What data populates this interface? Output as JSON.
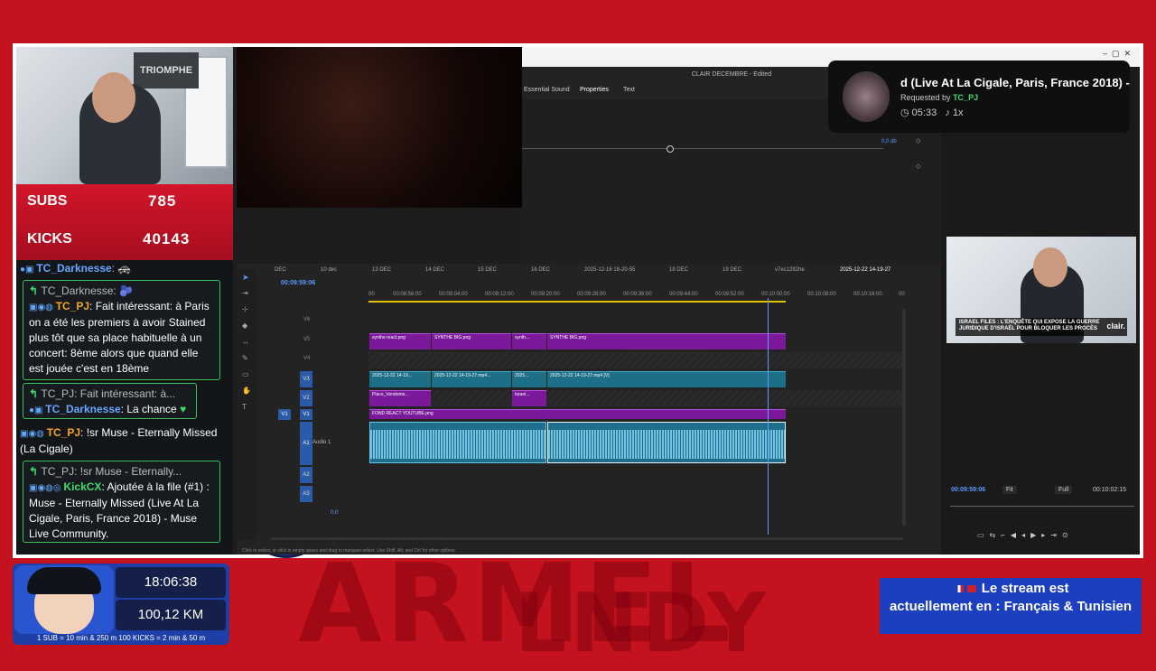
{
  "premiere": {
    "window_title": "CLAIR DECEMBRE - Edited",
    "tabs": [
      "Essential Sound",
      "Properties",
      "Text"
    ],
    "panel_value": "0,0 db",
    "timecode": "00:09:59:06",
    "sequence_tabs": [
      "DEC",
      "10 dec",
      "13 DEC",
      "14 DEC",
      "15 DEC",
      "16 DEC",
      "2025-12-16 16-20-55",
      "18 DEC",
      "19 DEC",
      "v7ec1282he",
      "2025-12-22 14-19-27"
    ],
    "ruler_ticks": [
      "00",
      "00:08:56:00",
      "00:09:04:00",
      "00:09:12:00",
      "00:09:20:00",
      "00:09:28:00",
      "00:09:36:00",
      "00:09:44:00",
      "00:09:52:00",
      "00:10:00:00",
      "00:10:08:00",
      "00:10:16:00",
      "00"
    ],
    "track_labels": [
      "V6",
      "V5",
      "V4",
      "V3",
      "V2",
      "V1",
      "A1",
      "A2",
      "A3",
      "0,0"
    ],
    "audio_track_name": "Audio 1",
    "clips": {
      "v5": [
        "synthe react.png",
        "SYNTHE BIG.png",
        "synth...",
        "SYNTHE BIG.png"
      ],
      "v3": [
        "2025-12-22 14-19...",
        "2025-12-22 14-19-27.mp4...",
        "2025...",
        "2025-12-22 14-19-27.mp4 [V]"
      ],
      "v2": [
        "Place_Vendome...",
        "Israel..."
      ],
      "v1": [
        "FOND REACT YOUTUBE.png"
      ]
    },
    "status_text": "Click to select, or click in empty space and drag to marquee select. Use Shift, Alt, and Ctrl for other options.",
    "program_timecode": "00:09:59:06",
    "program_end": "00:10:02:15",
    "fit_label": "Fit",
    "full_label": "Full"
  },
  "now_playing": {
    "title": "d (Live At La Cigale, Paris, France 2018) -",
    "requested_prefix": "Requested by",
    "requester": "TC_PJ",
    "duration": "05:33",
    "speed": "1x"
  },
  "overlay": {
    "subs_label": "SUBS",
    "subs_value": "785",
    "kicks_label": "KICKS",
    "kicks_value": "40143",
    "cam_poster": "TRIOMPHE",
    "cam2_banner": "ISRAEL FILES : L'ENQUÊTE QUI EXPOSE LA GUERRE JURIDIQUE D'ISRAËL POUR BLOQUER LES PROCÈS",
    "cam2_logo": "clair."
  },
  "chat": [
    {
      "user": "TC_Darknesse",
      "text": ""
    },
    {
      "user": "TC_Darknesse",
      "text": ""
    },
    {
      "user": "TC_PJ",
      "text": "Fait intéressant: à Paris on a été les premiers à avoir Stained plus tôt que sa place habituelle à un concert: 8ème alors que quand elle est jouée c'est en 18ème"
    },
    {
      "reply_user": "TC_PJ",
      "reply_text": "Fait intéressant: à...",
      "user": "TC_Darknesse",
      "text": "La chance"
    },
    {
      "user": "TC_PJ",
      "text": "!sr Muse - Eternally Missed (La Cigale)"
    },
    {
      "reply_user": "TC_PJ",
      "reply_text": "!sr Muse - Eternally...",
      "user": "KickCX",
      "text": "Ajoutée à la file (#1) : Muse - Eternally Missed (Live At La Cigale, Paris, France 2018) - Muse Live Community."
    }
  ],
  "bottom": {
    "clock": "18:06:38",
    "distance": "100,12 KM",
    "rules": "1 SUB = 10 min & 250 m     100 KICKS = 2 min & 50 m",
    "lang_line1": "Le stream est",
    "lang_line2": "actuellement en : Français & Tunisien"
  },
  "background": {
    "words": [
      "ARMEL",
      "LNDY"
    ]
  },
  "colors": {
    "accent_red": "#c4121e",
    "chat_border": "#3bbf5a",
    "timeline_video": "#7a1a9a",
    "timeline_teal": "#1c6f86",
    "lang_blue": "#1c3fc0"
  }
}
